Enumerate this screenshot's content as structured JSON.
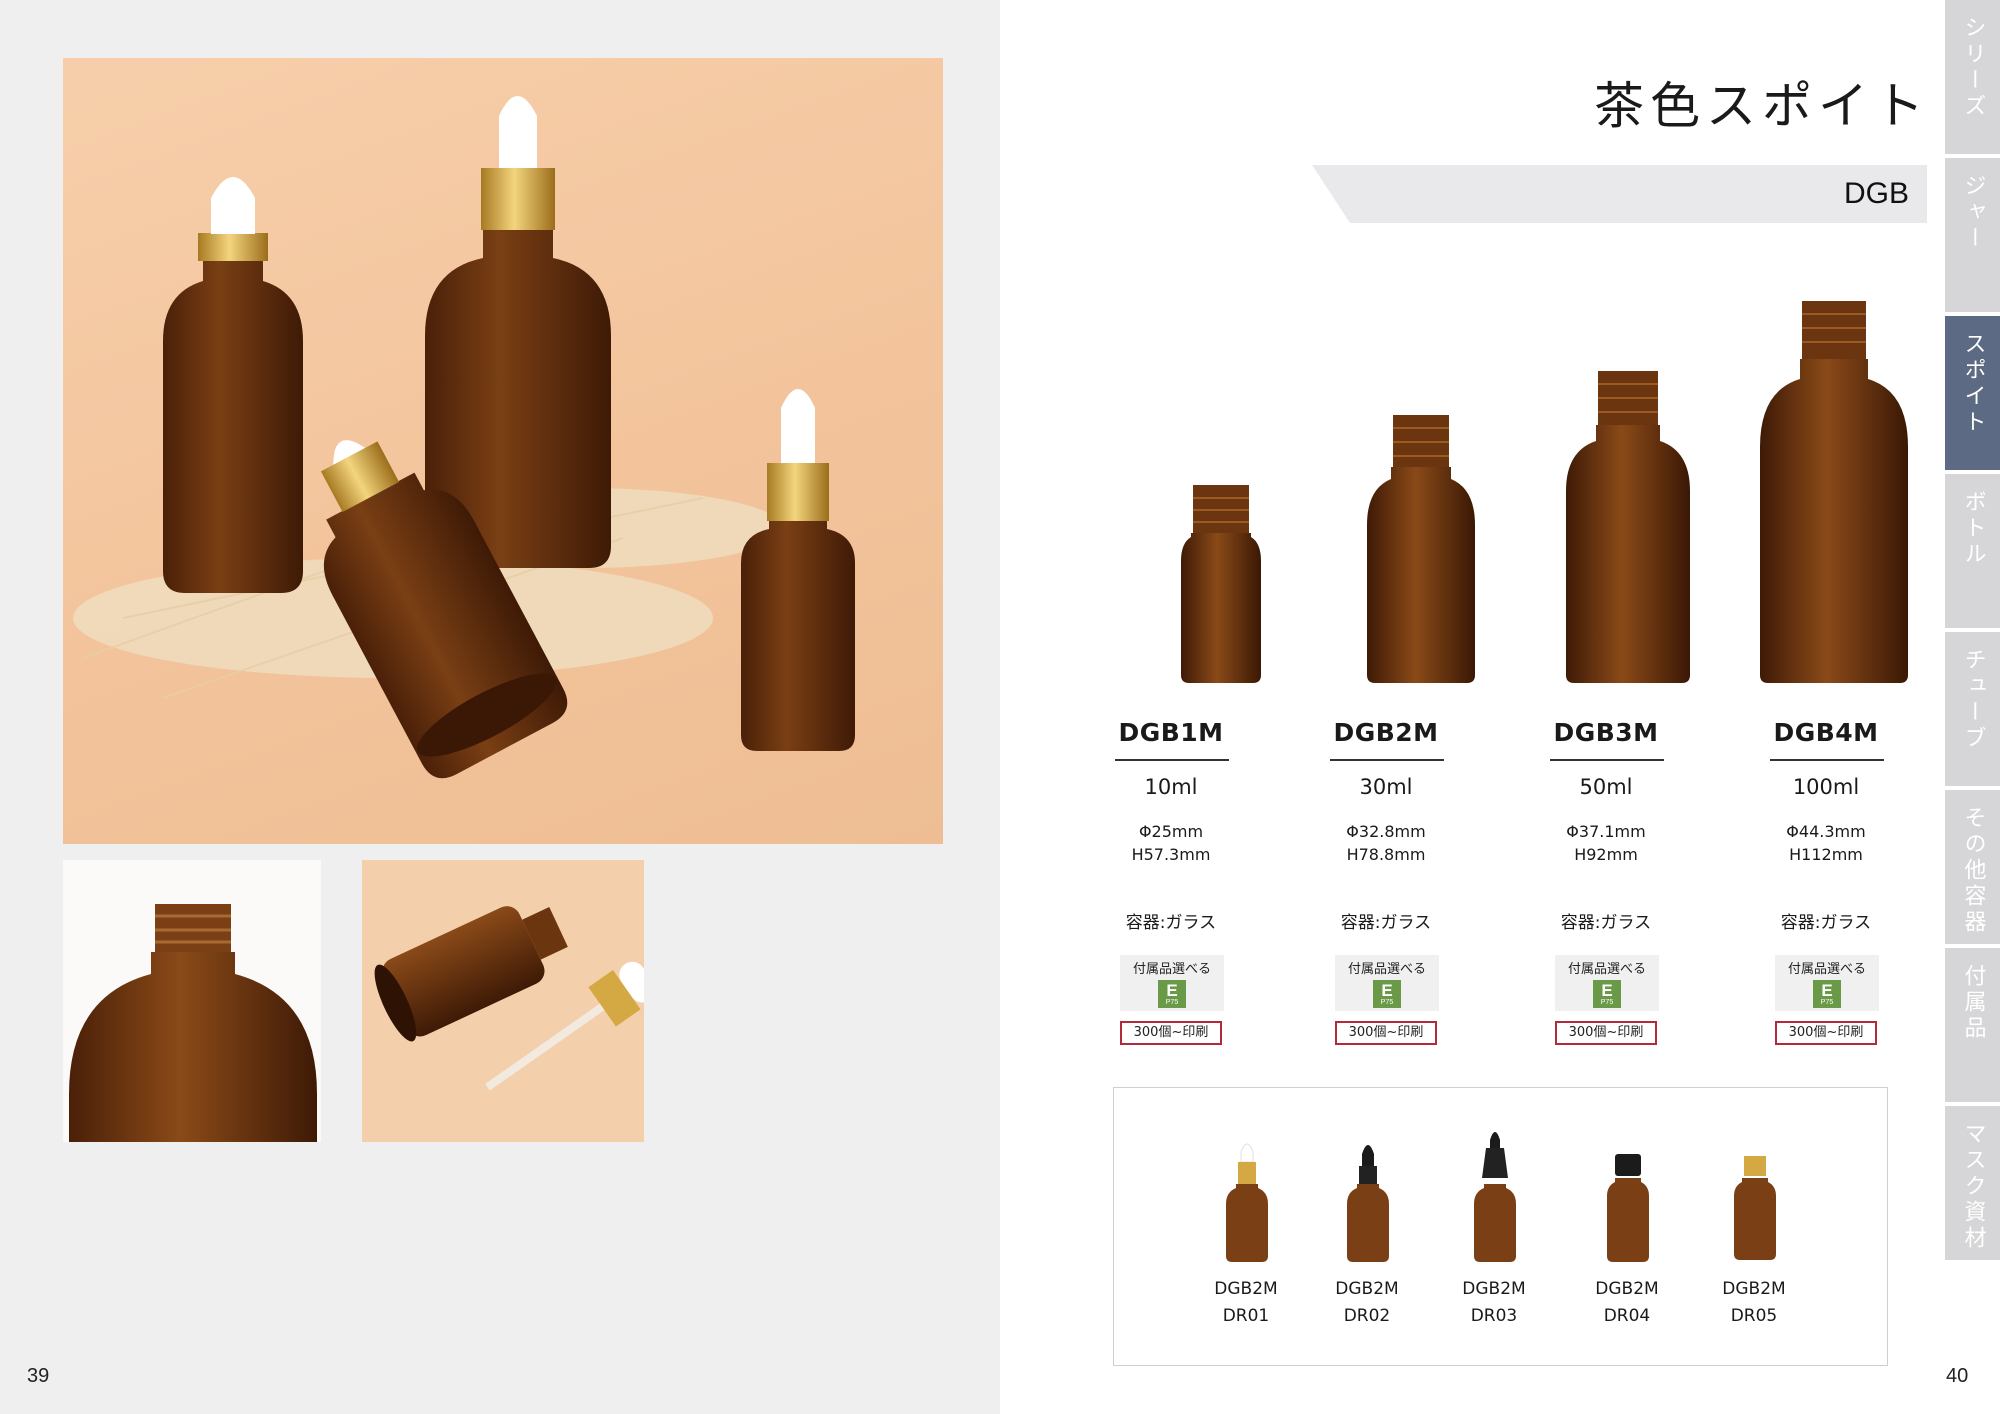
{
  "page_numbers": {
    "left": "39",
    "right": "40"
  },
  "title": "茶色スポイト",
  "series_code": "DGB",
  "side_tabs": [
    {
      "label": "シリーズ",
      "active": false
    },
    {
      "label": "ジャー",
      "active": false
    },
    {
      "label": "スポイト",
      "active": true
    },
    {
      "label": "ボトル",
      "active": false
    },
    {
      "label": "チューブ",
      "active": false
    },
    {
      "label": "その他容器",
      "active": false
    },
    {
      "label": "付属品",
      "active": false
    },
    {
      "label": "マスク資材",
      "active": false
    }
  ],
  "products": [
    {
      "code": "DGB1M",
      "volume": "10ml",
      "diameter": "Φ25mm",
      "height": "H57.3mm",
      "material": "容器:ガラス",
      "accessory_label": "付属品選べる",
      "accessory_badge": "E",
      "accessory_page": "P75",
      "print_note": "300個~印刷"
    },
    {
      "code": "DGB2M",
      "volume": "30ml",
      "diameter": "Φ32.8mm",
      "height": "H78.8mm",
      "material": "容器:ガラス",
      "accessory_label": "付属品選べる",
      "accessory_badge": "E",
      "accessory_page": "P75",
      "print_note": "300個~印刷"
    },
    {
      "code": "DGB3M",
      "volume": "50ml",
      "diameter": "Φ37.1mm",
      "height": "H92mm",
      "material": "容器:ガラス",
      "accessory_label": "付属品選べる",
      "accessory_badge": "E",
      "accessory_page": "P75",
      "print_note": "300個~印刷"
    },
    {
      "code": "DGB4M",
      "volume": "100ml",
      "diameter": "Φ44.3mm",
      "height": "H112mm",
      "material": "容器:ガラス",
      "accessory_label": "付属品選べる",
      "accessory_badge": "E",
      "accessory_page": "P75",
      "print_note": "300個~印刷"
    }
  ],
  "variants": [
    {
      "code": "DGB2M",
      "sub": "DR01",
      "cap": "gold-white"
    },
    {
      "code": "DGB2M",
      "sub": "DR02",
      "cap": "black-dropper"
    },
    {
      "code": "DGB2M",
      "sub": "DR03",
      "cap": "black-tall-dropper"
    },
    {
      "code": "DGB2M",
      "sub": "DR04",
      "cap": "black-screw"
    },
    {
      "code": "DGB2M",
      "sub": "DR05",
      "cap": "gold-screw"
    }
  ],
  "colors": {
    "amber": "#6b3510",
    "gold": "#d4a843",
    "accent_tab": "#5c6a84",
    "badge_green": "#6a9a48",
    "print_border": "#b32a3b"
  }
}
